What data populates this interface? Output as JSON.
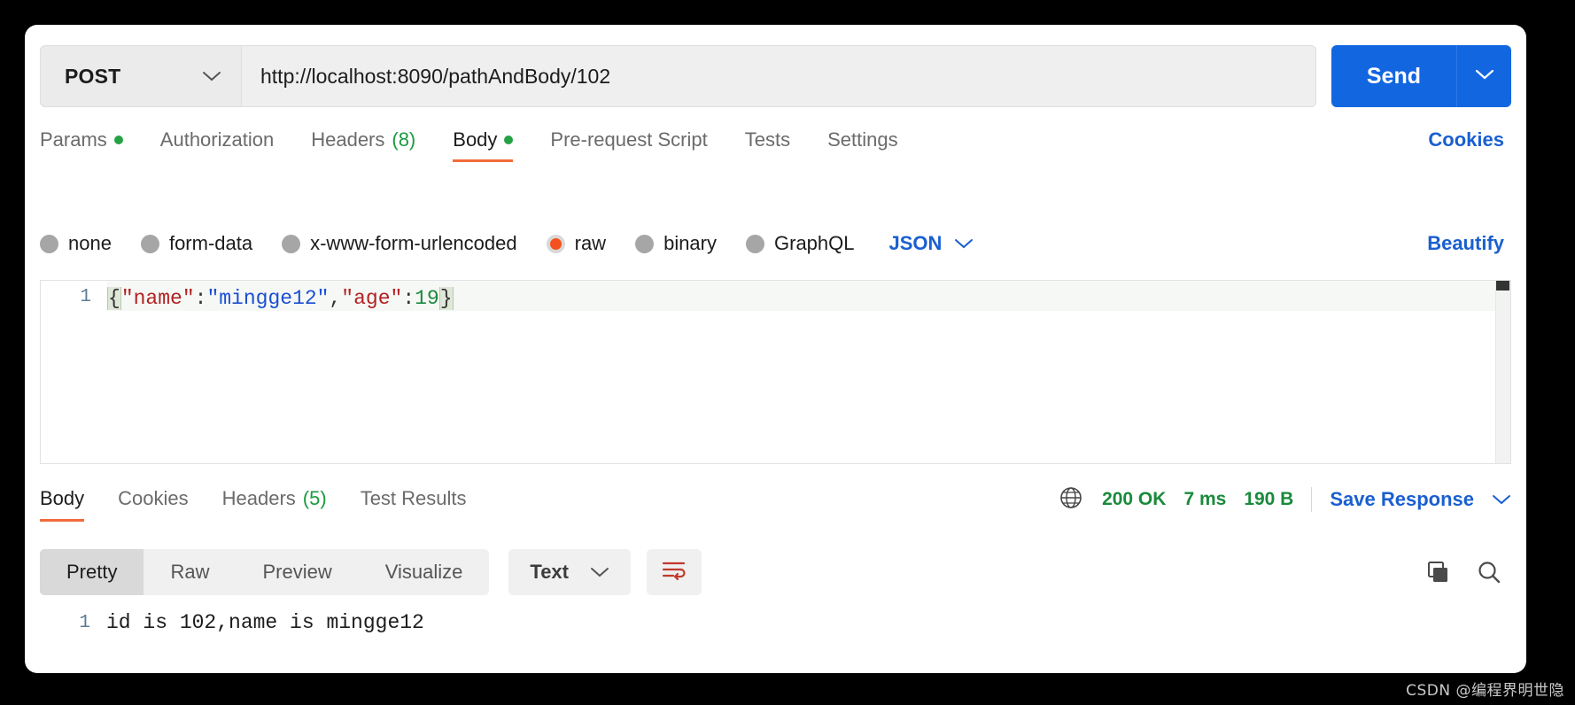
{
  "request": {
    "method": "POST",
    "url": "http://localhost:8090/pathAndBody/102",
    "send_label": "Send",
    "tabs": [
      {
        "label": "Params",
        "badge": "",
        "dot": true,
        "active": false
      },
      {
        "label": "Authorization",
        "badge": "",
        "dot": false,
        "active": false
      },
      {
        "label": "Headers",
        "badge": "(8)",
        "dot": false,
        "active": false
      },
      {
        "label": "Body",
        "badge": "",
        "dot": true,
        "active": true
      },
      {
        "label": "Pre-request Script",
        "badge": "",
        "dot": false,
        "active": false
      },
      {
        "label": "Tests",
        "badge": "",
        "dot": false,
        "active": false
      },
      {
        "label": "Settings",
        "badge": "",
        "dot": false,
        "active": false
      }
    ],
    "cookies_label": "Cookies",
    "body_types": [
      {
        "label": "none",
        "selected": false
      },
      {
        "label": "form-data",
        "selected": false
      },
      {
        "label": "x-www-form-urlencoded",
        "selected": false
      },
      {
        "label": "raw",
        "selected": true
      },
      {
        "label": "binary",
        "selected": false
      },
      {
        "label": "GraphQL",
        "selected": false
      }
    ],
    "raw_format": "JSON",
    "beautify_label": "Beautify",
    "editor": {
      "line_number": "1",
      "tokens": [
        {
          "text": "{",
          "type": "brace"
        },
        {
          "text": "\"name\"",
          "type": "key"
        },
        {
          "text": ":",
          "type": "punct"
        },
        {
          "text": "\"mingge12\"",
          "type": "str"
        },
        {
          "text": ",",
          "type": "punct"
        },
        {
          "text": "\"age\"",
          "type": "key"
        },
        {
          "text": ":",
          "type": "punct"
        },
        {
          "text": "19",
          "type": "num"
        },
        {
          "text": "}",
          "type": "brace"
        }
      ],
      "raw_text": "{\"name\":\"mingge12\",\"age\":19}"
    }
  },
  "response": {
    "tabs": [
      {
        "label": "Body",
        "badge": "",
        "active": true
      },
      {
        "label": "Cookies",
        "badge": "",
        "active": false
      },
      {
        "label": "Headers",
        "badge": "(5)",
        "active": false
      },
      {
        "label": "Test Results",
        "badge": "",
        "active": false
      }
    ],
    "status": "200 OK",
    "time": "7 ms",
    "size": "190 B",
    "save_response_label": "Save Response",
    "view_modes": [
      {
        "label": "Pretty",
        "active": true
      },
      {
        "label": "Raw",
        "active": false
      },
      {
        "label": "Preview",
        "active": false
      },
      {
        "label": "Visualize",
        "active": false
      }
    ],
    "format": "Text",
    "body": {
      "line_number": "1",
      "text": "id is 102,name is mingge12"
    }
  },
  "watermark": "CSDN @编程界明世隐",
  "colors": {
    "accent_blue": "#1266e0",
    "link_blue": "#1a5fd0",
    "active_orange": "#f26b3a",
    "status_green": "#1a8a3c",
    "radio_selected": "#f4511e"
  }
}
